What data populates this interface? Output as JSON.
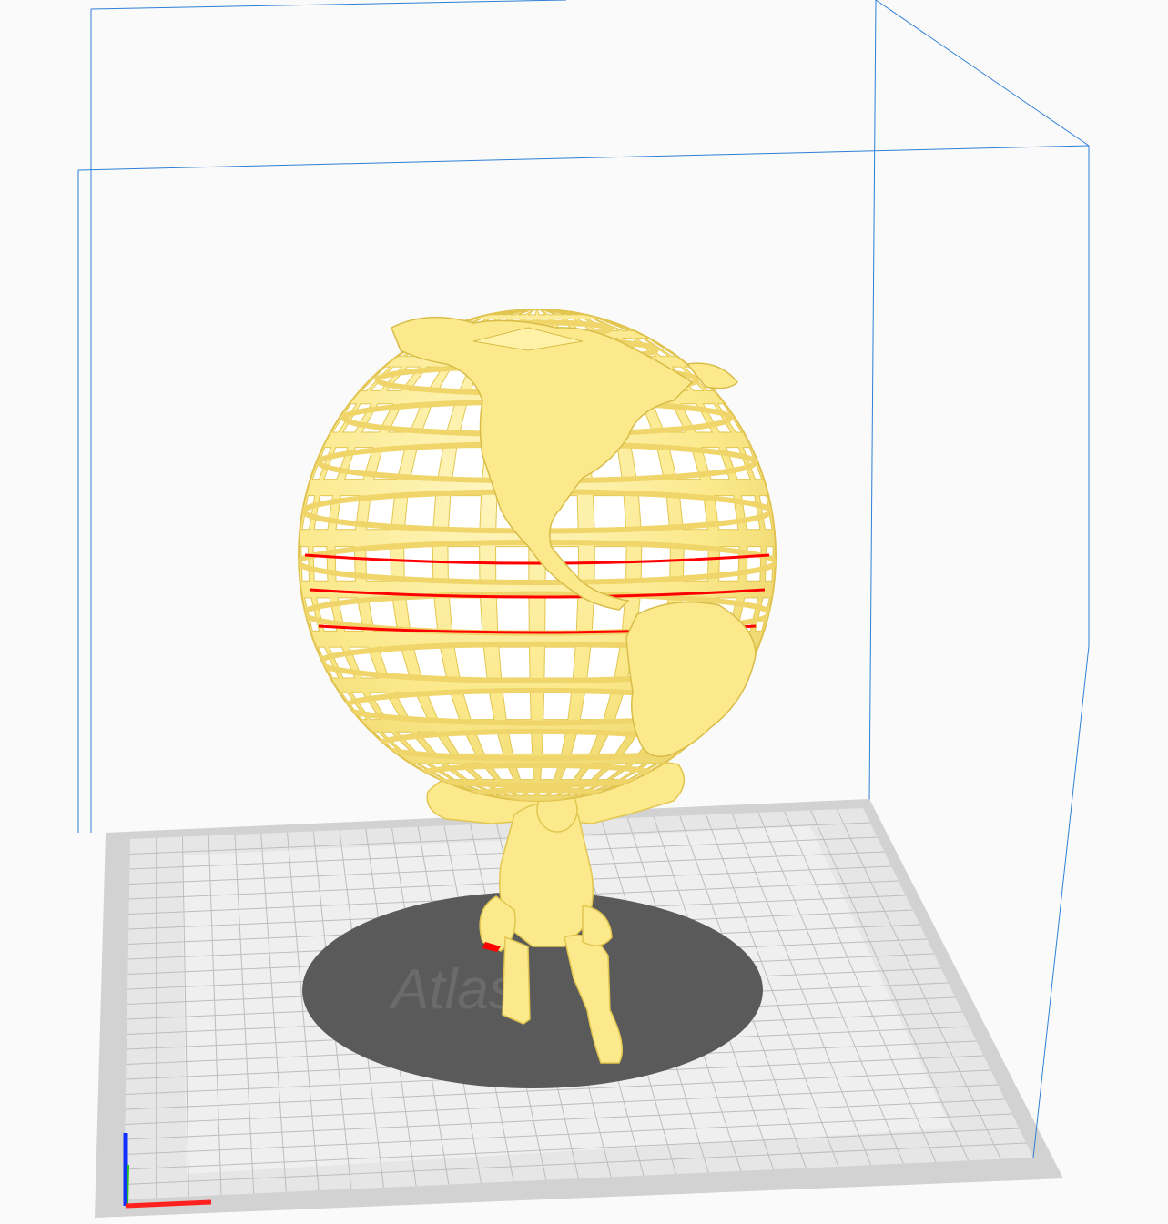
{
  "app": {
    "view": "3d-print-preview",
    "colors": {
      "background": "#fafafa",
      "build_volume_outline": "#2e7fd6",
      "plate_outer": "#d0d0d0",
      "plate_inner": "#ececec",
      "grid_line": "#b9b9b9",
      "model": "#fbe98b",
      "model_shade": "#e6c84e",
      "overhang": "#ff0000",
      "shadow": "#555555",
      "axis_x": "#ff2020",
      "axis_y": "#20c020",
      "axis_z": "#1030ff"
    },
    "model": {
      "name": "atlas-holding-globe",
      "icon": "globe-icon"
    }
  }
}
